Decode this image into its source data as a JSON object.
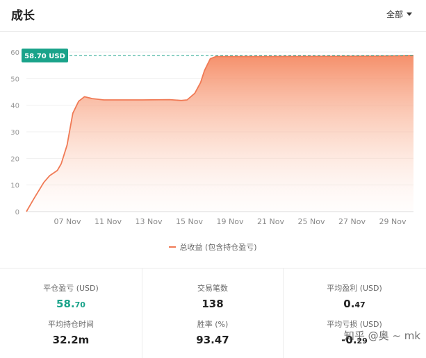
{
  "header": {
    "title": "成长",
    "range": "全部"
  },
  "chart_data": {
    "type": "area",
    "ylim": [
      0,
      60
    ],
    "y_ticks": [
      "0",
      "10",
      "20",
      "30",
      "40",
      "50",
      "60"
    ],
    "x_ticks": [
      "07 Nov",
      "11 Nov",
      "13 Nov",
      "15 Nov",
      "19 Nov",
      "21 Nov",
      "25 Nov",
      "27 Nov",
      "29 Nov"
    ],
    "series": [
      {
        "name": "总收益 (包含持仓盈亏)",
        "color": "#f07a55",
        "points": [
          [
            0.0,
            0.0
          ],
          [
            0.02,
            5.0
          ],
          [
            0.045,
            11.0
          ],
          [
            0.06,
            13.5
          ],
          [
            0.08,
            15.5
          ],
          [
            0.09,
            18.0
          ],
          [
            0.105,
            25.0
          ],
          [
            0.12,
            37.0
          ],
          [
            0.135,
            41.5
          ],
          [
            0.15,
            43.2
          ],
          [
            0.17,
            42.5
          ],
          [
            0.2,
            42.0
          ],
          [
            0.3,
            42.0
          ],
          [
            0.37,
            42.1
          ],
          [
            0.4,
            41.8
          ],
          [
            0.415,
            42.0
          ],
          [
            0.435,
            44.5
          ],
          [
            0.45,
            48.5
          ],
          [
            0.46,
            53.0
          ],
          [
            0.475,
            57.5
          ],
          [
            0.49,
            58.3
          ],
          [
            0.6,
            58.3
          ],
          [
            0.8,
            58.4
          ],
          [
            0.92,
            58.5
          ],
          [
            1.0,
            58.7
          ]
        ]
      }
    ],
    "marker": {
      "label": "58.70 USD",
      "value": 58.7,
      "color": "#1aa38a"
    }
  },
  "legend": {
    "label": "总收益 (包含持仓盈亏)"
  },
  "stats": {
    "c0r0": {
      "label": "平仓盈亏 (USD)",
      "int": "58.",
      "dec": "70"
    },
    "c0r1": {
      "label": "平均持仓时间",
      "value": "32.2m"
    },
    "c1r0": {
      "label": "交易笔数",
      "value": "138"
    },
    "c1r1": {
      "label": "胜率 (%)",
      "value": "93.47"
    },
    "c2r0": {
      "label": "平均盈利 (USD)",
      "int": "0.",
      "dec": "47"
    },
    "c2r1": {
      "label": "平均亏损 (USD)",
      "int": "-0.",
      "dec": "29"
    }
  },
  "watermark": "知乎 @奥 ~ mk"
}
